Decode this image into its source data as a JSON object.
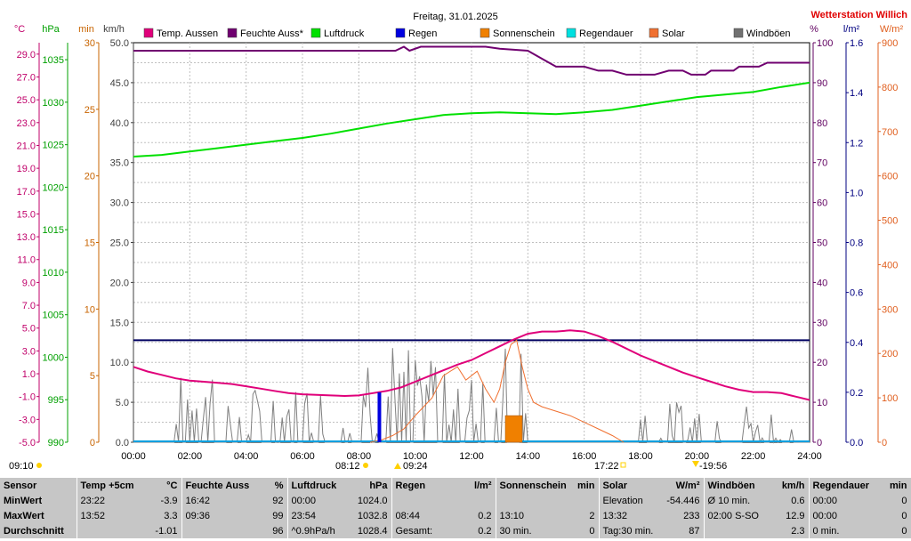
{
  "chart_data": {
    "type": "line",
    "title": "Freitag, 31.01.2025",
    "station": "Wetterstation Willich",
    "x_ticks": [
      "00:00",
      "02:00",
      "04:00",
      "06:00",
      "08:00",
      "10:00",
      "12:00",
      "14:00",
      "16:00",
      "18:00",
      "20:00",
      "22:00",
      "24:00"
    ],
    "x_range_hours": [
      0,
      24
    ],
    "left_axes": [
      {
        "unit": "°C",
        "color": "#c0006a",
        "ticks": [
          "29.0",
          "27.0",
          "25.0",
          "23.0",
          "21.0",
          "19.0",
          "17.0",
          "15.0",
          "13.0",
          "11.0",
          "9.0",
          "7.0",
          "5.0",
          "3.0",
          "1.0",
          "-1.0",
          "-3.0",
          "-5.0"
        ],
        "range": [
          -5,
          30
        ]
      },
      {
        "unit": "hPa",
        "color": "#00a000",
        "ticks": [
          "1035",
          "1030",
          "1025",
          "1020",
          "1015",
          "1010",
          "1005",
          "1000",
          "995",
          "990"
        ],
        "range": [
          990,
          1037
        ]
      },
      {
        "unit": "min",
        "color": "#c86400",
        "ticks": [
          "30",
          "25",
          "20",
          "15",
          "10",
          "5",
          "0"
        ],
        "range": [
          0,
          30
        ]
      },
      {
        "unit": "km/h",
        "color": "#404040",
        "ticks": [
          "50.0",
          "45.0",
          "40.0",
          "35.0",
          "30.0",
          "25.0",
          "20.0",
          "15.0",
          "10.0",
          "5.0",
          "0.0"
        ],
        "range": [
          0,
          50
        ]
      }
    ],
    "right_axes": [
      {
        "unit": "%",
        "color": "#600060",
        "ticks": [
          "100",
          "90",
          "80",
          "70",
          "60",
          "50",
          "40",
          "30",
          "20",
          "10",
          "0"
        ],
        "range": [
          0,
          100
        ]
      },
      {
        "unit": "l/m²",
        "color": "#000080",
        "ticks": [
          "1.6",
          "1.4",
          "1.2",
          "1.0",
          "0.8",
          "0.6",
          "0.4",
          "0.2",
          "0.0"
        ],
        "range": [
          0,
          1.6
        ]
      },
      {
        "unit": "W/m²",
        "color": "#e06020",
        "ticks": [
          "900",
          "800",
          "700",
          "600",
          "500",
          "400",
          "300",
          "200",
          "100",
          "0"
        ],
        "range": [
          0,
          900
        ]
      }
    ],
    "legend": [
      {
        "name": "Temp. Aussen",
        "color": "#e0007a"
      },
      {
        "name": "Feuchte Auss*",
        "color": "#700070"
      },
      {
        "name": "Luftdruck",
        "color": "#00e000"
      },
      {
        "name": "Regen",
        "color": "#0000e0"
      },
      {
        "name": "Sonnenschein",
        "color": "#f08000"
      },
      {
        "name": "Regendauer",
        "color": "#00e0e0"
      },
      {
        "name": "Solar",
        "color": "#f07030"
      },
      {
        "name": "Windböen",
        "color": "#707070"
      }
    ],
    "series": [
      {
        "name": "Temp. Aussen",
        "color": "#e0007a",
        "axis": "°C",
        "points": [
          [
            0,
            1.6
          ],
          [
            0.5,
            1.2
          ],
          [
            1,
            0.9
          ],
          [
            1.5,
            0.6
          ],
          [
            2,
            0.4
          ],
          [
            2.5,
            0.3
          ],
          [
            3,
            0.2
          ],
          [
            3.5,
            0.1
          ],
          [
            4,
            -0.1
          ],
          [
            4.5,
            -0.3
          ],
          [
            5,
            -0.5
          ],
          [
            5.5,
            -0.7
          ],
          [
            6,
            -0.8
          ],
          [
            6.5,
            -0.85
          ],
          [
            7,
            -0.9
          ],
          [
            7.5,
            -0.95
          ],
          [
            8,
            -0.9
          ],
          [
            8.5,
            -0.7
          ],
          [
            9,
            -0.5
          ],
          [
            9.5,
            -0.2
          ],
          [
            10,
            0.3
          ],
          [
            10.5,
            0.8
          ],
          [
            11,
            1.3
          ],
          [
            11.5,
            1.8
          ],
          [
            12,
            2.2
          ],
          [
            12.5,
            2.8
          ],
          [
            13,
            3.4
          ],
          [
            13.5,
            4.0
          ],
          [
            14,
            4.5
          ],
          [
            14.5,
            4.7
          ],
          [
            15,
            4.7
          ],
          [
            15.5,
            4.8
          ],
          [
            16,
            4.7
          ],
          [
            16.5,
            4.3
          ],
          [
            17,
            3.8
          ],
          [
            17.5,
            3.2
          ],
          [
            18,
            2.6
          ],
          [
            18.5,
            2.1
          ],
          [
            19,
            1.6
          ],
          [
            19.5,
            1.1
          ],
          [
            20,
            0.7
          ],
          [
            20.5,
            0.3
          ],
          [
            21,
            -0.1
          ],
          [
            21.5,
            -0.4
          ],
          [
            22,
            -0.6
          ],
          [
            22.5,
            -0.6
          ],
          [
            23,
            -0.7
          ],
          [
            23.5,
            -1.0
          ],
          [
            24,
            -1.3
          ]
        ]
      },
      {
        "name": "Feuchte Auss*",
        "color": "#700070",
        "axis": "%",
        "points": [
          [
            0,
            98
          ],
          [
            9.3,
            98
          ],
          [
            9.6,
            99
          ],
          [
            9.8,
            98
          ],
          [
            10.2,
            99
          ],
          [
            12.5,
            99
          ],
          [
            13,
            98.5
          ],
          [
            14,
            98
          ],
          [
            14.5,
            96
          ],
          [
            15,
            94
          ],
          [
            16,
            94
          ],
          [
            16.5,
            93
          ],
          [
            17,
            93
          ],
          [
            17.5,
            92
          ],
          [
            18.5,
            92
          ],
          [
            19,
            93
          ],
          [
            19.5,
            93
          ],
          [
            19.8,
            92
          ],
          [
            20.3,
            92
          ],
          [
            20.5,
            93
          ],
          [
            21.3,
            93
          ],
          [
            21.5,
            94
          ],
          [
            22.2,
            94
          ],
          [
            22.5,
            95
          ],
          [
            24,
            95
          ]
        ]
      },
      {
        "name": "Luftdruck",
        "color": "#00e000",
        "axis": "hPa",
        "points": [
          [
            0,
            1023.6
          ],
          [
            1,
            1023.8
          ],
          [
            2,
            1024.2
          ],
          [
            3,
            1024.6
          ],
          [
            4,
            1025.0
          ],
          [
            5,
            1025.4
          ],
          [
            6,
            1025.8
          ],
          [
            7,
            1026.3
          ],
          [
            8,
            1026.9
          ],
          [
            9,
            1027.5
          ],
          [
            10,
            1028.0
          ],
          [
            11,
            1028.5
          ],
          [
            12,
            1028.7
          ],
          [
            13,
            1028.8
          ],
          [
            14,
            1028.7
          ],
          [
            15,
            1028.6
          ],
          [
            16,
            1028.8
          ],
          [
            17,
            1029.1
          ],
          [
            18,
            1029.6
          ],
          [
            19,
            1030.1
          ],
          [
            20,
            1030.6
          ],
          [
            21,
            1030.9
          ],
          [
            22,
            1031.2
          ],
          [
            23,
            1031.8
          ],
          [
            24,
            1032.3
          ]
        ]
      },
      {
        "name": "Solar",
        "color": "#f07030",
        "axis": "W/m²",
        "points": [
          [
            8.4,
            0
          ],
          [
            8.8,
            5
          ],
          [
            9.2,
            15
          ],
          [
            9.6,
            30
          ],
          [
            10,
            60
          ],
          [
            10.3,
            80
          ],
          [
            10.6,
            100
          ],
          [
            11,
            150
          ],
          [
            11.5,
            170
          ],
          [
            11.8,
            140
          ],
          [
            12.2,
            160
          ],
          [
            12.5,
            120
          ],
          [
            12.8,
            90
          ],
          [
            13,
            120
          ],
          [
            13.2,
            180
          ],
          [
            13.4,
            220
          ],
          [
            13.6,
            230
          ],
          [
            13.8,
            170
          ],
          [
            14,
            120
          ],
          [
            14.2,
            90
          ],
          [
            14.5,
            80
          ],
          [
            15,
            70
          ],
          [
            15.5,
            60
          ],
          [
            16,
            45
          ],
          [
            16.5,
            30
          ],
          [
            17,
            15
          ],
          [
            17.4,
            0
          ]
        ]
      },
      {
        "name": "Regen",
        "color": "#0000e0",
        "axis": "l/m²",
        "points": [
          [
            8.73,
            0
          ],
          [
            8.73,
            0.2
          ]
        ]
      },
      {
        "name": "Sonnenschein",
        "color": "#f08000",
        "axis": "min",
        "points": [
          [
            13.2,
            2
          ],
          [
            13.8,
            2
          ]
        ]
      },
      {
        "name": "Regendauer",
        "color": "#00e0e0",
        "axis": "min",
        "points": [
          [
            0,
            0
          ],
          [
            24,
            0
          ]
        ]
      }
    ],
    "markers": [
      {
        "time": "09:10",
        "label": "09:10"
      },
      {
        "time": "08:12",
        "label": "08:12"
      },
      {
        "time": "09:24",
        "label": "09:24"
      },
      {
        "time": "17:22",
        "label": "17:22"
      },
      {
        "time": "19:56",
        "label": "19:56"
      }
    ],
    "reference_line_hpa": 1002
  },
  "stats": {
    "header": [
      {
        "title": "Sensor",
        "unit": ""
      },
      {
        "title": "Temp +5cm",
        "unit": "°C"
      },
      {
        "title": "Feuchte Auss",
        "unit": "%"
      },
      {
        "title": "Luftdruck",
        "unit": "hPa"
      },
      {
        "title": "Regen",
        "unit": "l/m²"
      },
      {
        "title": "Sonnenschein",
        "unit": "min"
      },
      {
        "title": "Solar",
        "unit": "W/m²"
      },
      {
        "title": "Windböen",
        "unit": "km/h"
      },
      {
        "title": "Regendauer",
        "unit": "min"
      }
    ],
    "rows": [
      {
        "label": "MinWert",
        "cells": [
          [
            "23:22",
            "-3.9"
          ],
          [
            "16:42",
            "92"
          ],
          [
            "00:00",
            "1024.0"
          ],
          [
            "",
            ""
          ],
          [
            "",
            ""
          ],
          [
            "Elevation",
            "-54.446"
          ],
          [
            "Ø 10 min.",
            "0.6"
          ],
          [
            "00:00",
            "0"
          ]
        ]
      },
      {
        "label": "MaxWert",
        "cells": [
          [
            "13:52",
            "3.3"
          ],
          [
            "09:36",
            "99"
          ],
          [
            "23:54",
            "1032.8"
          ],
          [
            "08:44",
            "0.2"
          ],
          [
            "13:10",
            "2"
          ],
          [
            "13:32",
            "233"
          ],
          [
            "02:00  S-SO",
            "12.9"
          ],
          [
            "00:00",
            "0"
          ]
        ]
      },
      {
        "label": "Durchschnitt",
        "cells": [
          [
            "",
            "-1.01"
          ],
          [
            "",
            "96"
          ],
          [
            "^0.9hPa/h",
            "1028.4"
          ],
          [
            "Gesamt:",
            "0.2"
          ],
          [
            "30 min.",
            "0"
          ],
          [
            "Tag:30 min.",
            "87"
          ],
          [
            "",
            "2.3"
          ],
          [
            "0 min.",
            "0"
          ]
        ]
      }
    ]
  }
}
